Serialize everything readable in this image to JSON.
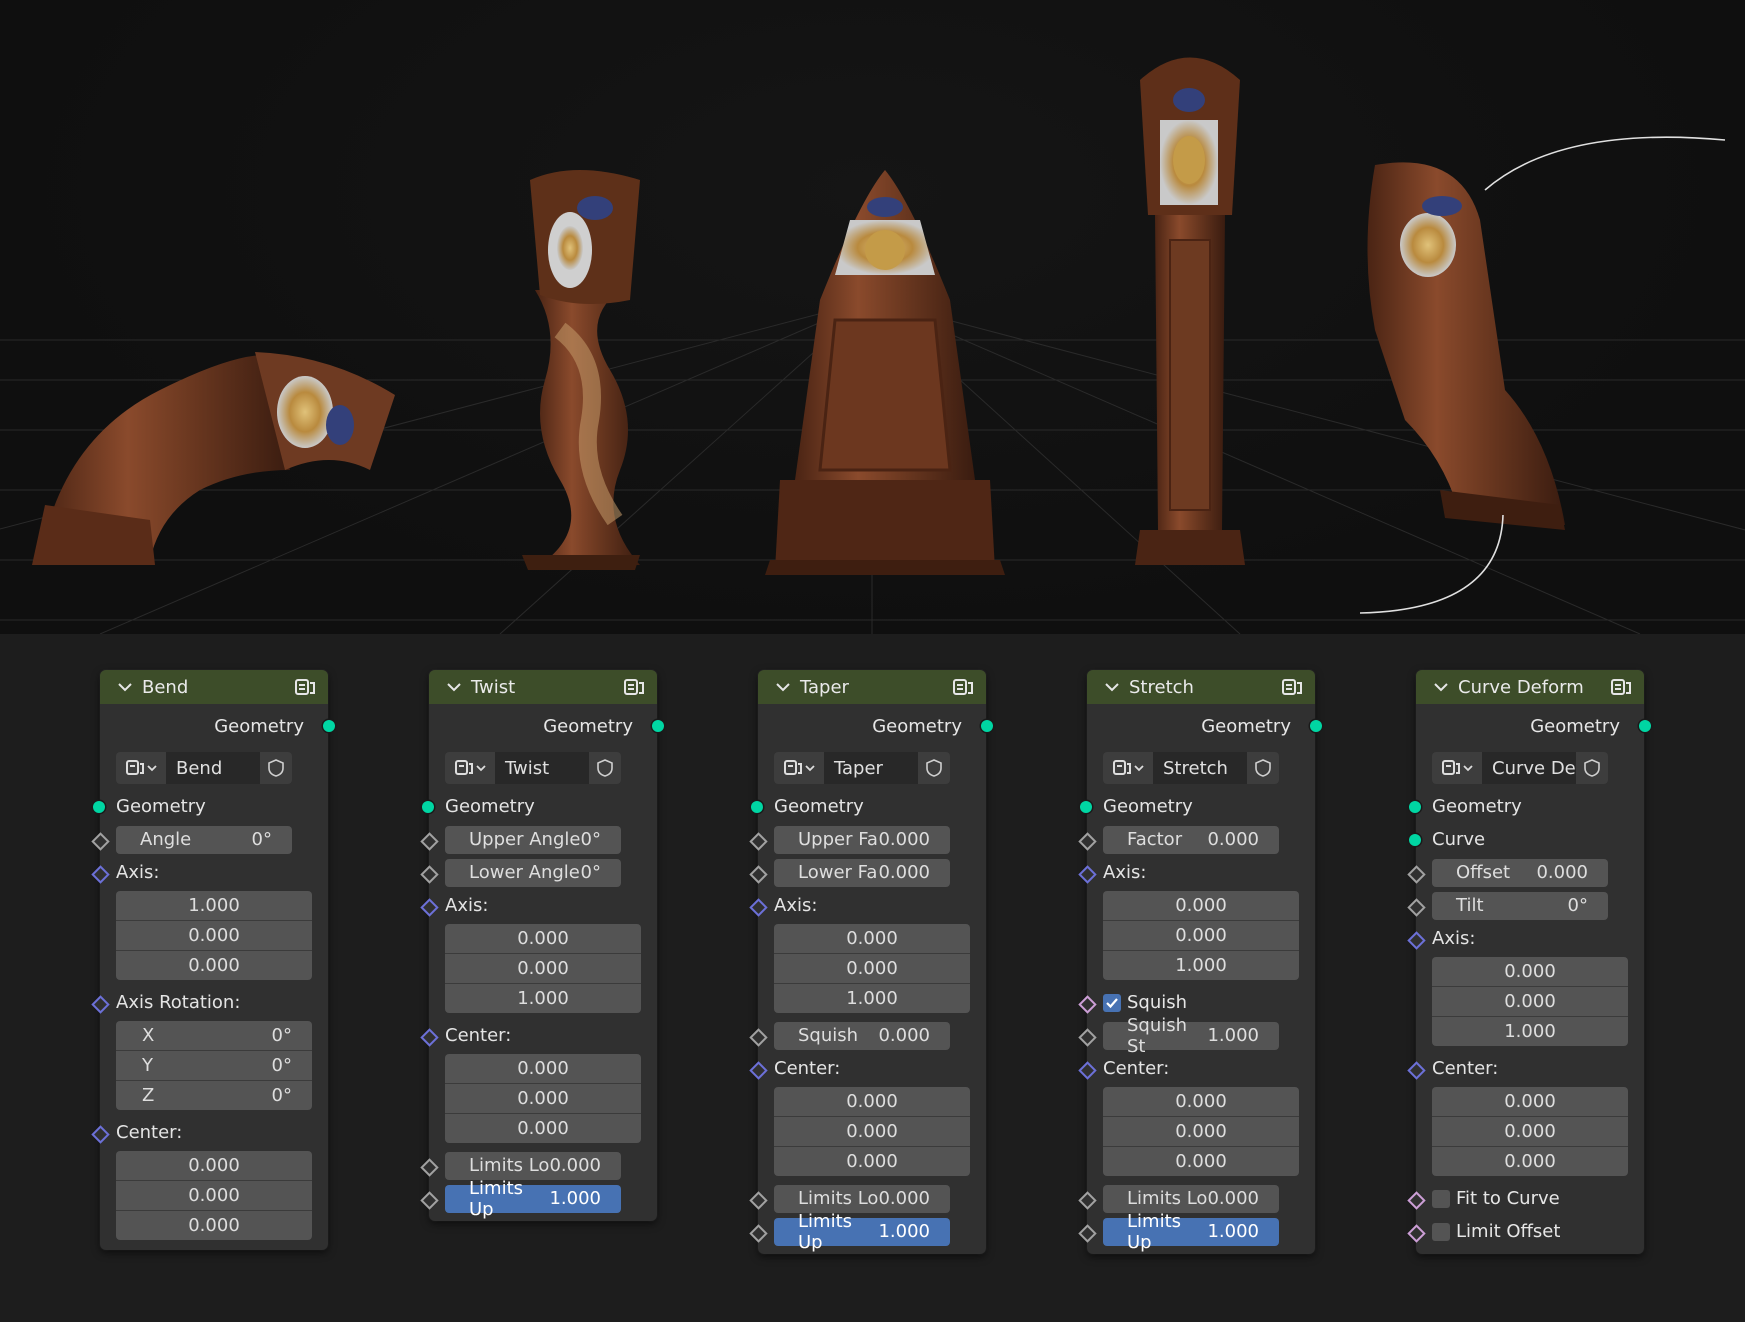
{
  "colors": {
    "header": "#3d4d29",
    "geometry_socket": "#00d6a3",
    "vector_socket": "#6c70d8",
    "bool_socket": "#cc9ed6",
    "highlight": "#4772b3",
    "node_body": "#303030"
  },
  "icons": {
    "collapse": "chevron-down-icon",
    "node_type": "modifier-node-icon",
    "modifier_dropdown": "modifier-dropdown-icon",
    "pin": "shield-icon",
    "checkbox_checked": "checkmark-icon"
  },
  "viewport": {
    "objects": [
      "bent-clock",
      "twisted-clock",
      "tapered-clock",
      "stretched-clock",
      "curve-deformed-clock"
    ]
  },
  "nodes": {
    "bend": {
      "title": "Bend",
      "output": "Geometry",
      "modifier": "Bend",
      "geometry": "Geometry",
      "angle_label": "Angle",
      "angle_value": "0°",
      "axis_label": "Axis:",
      "axis": [
        "1.000",
        "0.000",
        "0.000"
      ],
      "axis_rotation_label": "Axis Rotation:",
      "rot": [
        {
          "axis": "X",
          "value": "0°"
        },
        {
          "axis": "Y",
          "value": "0°"
        },
        {
          "axis": "Z",
          "value": "0°"
        }
      ],
      "center_label": "Center:",
      "center": [
        "0.000",
        "0.000",
        "0.000"
      ]
    },
    "twist": {
      "title": "Twist",
      "output": "Geometry",
      "modifier": "Twist",
      "geometry": "Geometry",
      "upper_label": "Upper Angle",
      "upper_value": "0°",
      "lower_label": "Lower Angle",
      "lower_value": "0°",
      "axis_label": "Axis:",
      "axis": [
        "0.000",
        "0.000",
        "1.000"
      ],
      "center_label": "Center:",
      "center": [
        "0.000",
        "0.000",
        "0.000"
      ],
      "limits_lo_label": "Limits Lo",
      "limits_lo_value": "0.000",
      "limits_up_label": "Limits Up",
      "limits_up_value": "1.000"
    },
    "taper": {
      "title": "Taper",
      "output": "Geometry",
      "modifier": "Taper",
      "geometry": "Geometry",
      "upper_label": "Upper Fa",
      "upper_value": "0.000",
      "lower_label": "Lower Fa",
      "lower_value": "0.000",
      "axis_label": "Axis:",
      "axis": [
        "0.000",
        "0.000",
        "1.000"
      ],
      "squish_label": "Squish",
      "squish_value": "0.000",
      "center_label": "Center:",
      "center": [
        "0.000",
        "0.000",
        "0.000"
      ],
      "limits_lo_label": "Limits Lo",
      "limits_lo_value": "0.000",
      "limits_up_label": "Limits Up",
      "limits_up_value": "1.000"
    },
    "stretch": {
      "title": "Stretch",
      "output": "Geometry",
      "modifier": "Stretch",
      "geometry": "Geometry",
      "factor_label": "Factor",
      "factor_value": "0.000",
      "axis_label": "Axis:",
      "axis": [
        "0.000",
        "0.000",
        "1.000"
      ],
      "squish_label": "Squish",
      "squish_checked": true,
      "squish_st_label": "Squish St",
      "squish_st_value": "1.000",
      "center_label": "Center:",
      "center": [
        "0.000",
        "0.000",
        "0.000"
      ],
      "limits_lo_label": "Limits Lo",
      "limits_lo_value": "0.000",
      "limits_up_label": "Limits Up",
      "limits_up_value": "1.000"
    },
    "curve": {
      "title": "Curve Deform",
      "output": "Geometry",
      "modifier": "Curve De...",
      "geometry": "Geometry",
      "curve_label": "Curve",
      "offset_label": "Offset",
      "offset_value": "0.000",
      "tilt_label": "Tilt",
      "tilt_value": "0°",
      "axis_label": "Axis:",
      "axis": [
        "0.000",
        "0.000",
        "1.000"
      ],
      "center_label": "Center:",
      "center": [
        "0.000",
        "0.000",
        "0.000"
      ],
      "fit_label": "Fit to Curve",
      "fit_checked": false,
      "limit_offset_label": "Limit Offset",
      "limit_offset_checked": false
    }
  }
}
